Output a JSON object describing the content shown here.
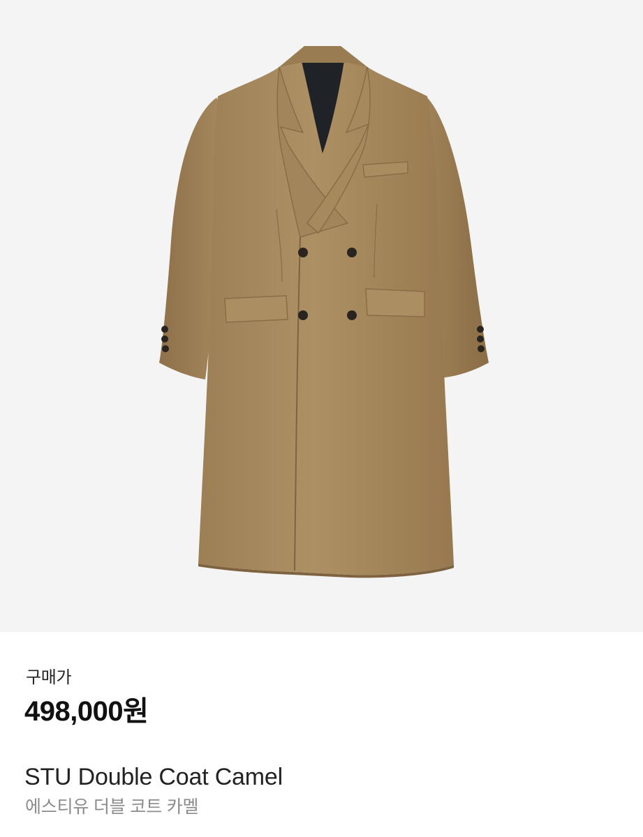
{
  "product": {
    "image_subject": "coat-image",
    "price_label": "구매가",
    "price": "498,000원",
    "name_en": "STU Double Coat Camel",
    "name_ko": "에스티유 더블 코트 카멜"
  },
  "colors": {
    "image_background": "#f4f4f4",
    "coat": "#a88b5f",
    "coat_shadow": "#8f744d",
    "lining": "#1f2328",
    "button": "#2a2420",
    "price_text": "#111111",
    "secondary_text": "#8b8b8b"
  }
}
